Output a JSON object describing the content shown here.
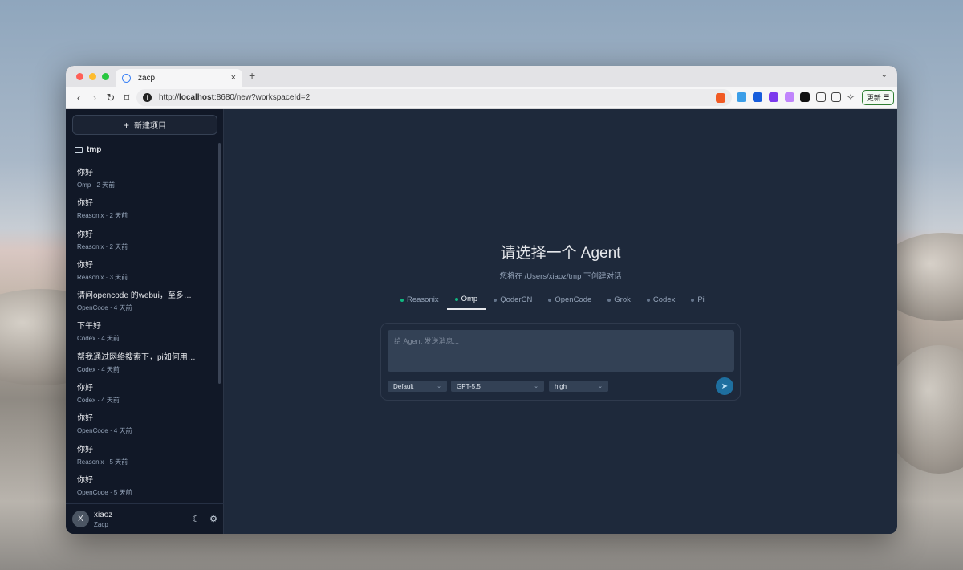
{
  "browser": {
    "tab_title": "zacp",
    "url_prefix": "http://",
    "url_host": "localhost",
    "url_path": ":8680/new?workspaceId=2",
    "update_button": "更新"
  },
  "sidebar": {
    "new_project": "新建项目",
    "folder": "tmp",
    "conversations": [
      {
        "title": "你好",
        "meta": "Omp · 2 天前"
      },
      {
        "title": "你好",
        "meta": "Reasonix · 2 天前"
      },
      {
        "title": "你好",
        "meta": "Reasonix · 2 天前"
      },
      {
        "title": "你好",
        "meta": "Reasonix · 3 天前"
      },
      {
        "title": "请问opencode 的webui，至多多...",
        "meta": "OpenCode · 4 天前"
      },
      {
        "title": "下午好",
        "meta": "Codex · 4 天前"
      },
      {
        "title": "帮我通过网络搜索下，pi如何用a...",
        "meta": "Codex · 4 天前"
      },
      {
        "title": "你好",
        "meta": "Codex · 4 天前"
      },
      {
        "title": "你好",
        "meta": "OpenCode · 4 天前"
      },
      {
        "title": "你好",
        "meta": "Reasonix · 5 天前"
      },
      {
        "title": "你好",
        "meta": "OpenCode · 5 天前"
      }
    ],
    "user": {
      "avatar": "X",
      "name": "xiaoz",
      "workspace": "Zacp"
    }
  },
  "main": {
    "title": "请选择一个 Agent",
    "subtitle": "您将在 /Users/xiaoz/tmp 下创建对话",
    "agents": [
      {
        "label": "Reasonix",
        "status": "online"
      },
      {
        "label": "Omp",
        "status": "online",
        "active": true
      },
      {
        "label": "QoderCN",
        "status": "offline"
      },
      {
        "label": "OpenCode",
        "status": "offline"
      },
      {
        "label": "Grok",
        "status": "offline"
      },
      {
        "label": "Codex",
        "status": "offline"
      },
      {
        "label": "Pi",
        "status": "offline"
      }
    ],
    "composer": {
      "placeholder": "给 Agent 发送消息...",
      "mode": "Default",
      "model": "GPT-5.5",
      "effort": "high"
    }
  },
  "colors": {
    "accent_online": "#10b981",
    "send": "#1e6f9f",
    "bg": "#1e293b",
    "sidebar": "#111827"
  }
}
